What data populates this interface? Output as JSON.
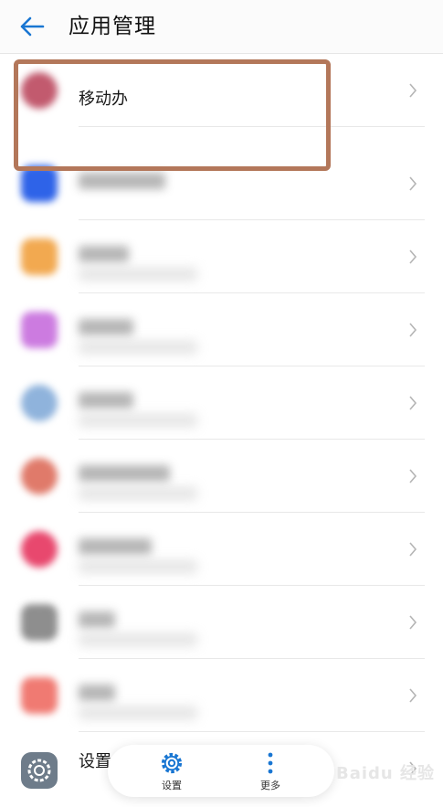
{
  "header": {
    "title": "应用管理"
  },
  "list": {
    "items": [
      {
        "label": "移动办",
        "color": "#c25a6e",
        "blurred_name": false
      },
      {
        "label": "",
        "color": "#2e63e8",
        "blurred_name": true
      },
      {
        "label": "",
        "color": "#f2a950",
        "blurred_name": true
      },
      {
        "label": "",
        "color": "#cc7be0",
        "blurred_name": true
      },
      {
        "label": "",
        "color": "#8fb3dc",
        "blurred_name": true
      },
      {
        "label": "",
        "color": "#e07a6a",
        "blurred_name": true
      },
      {
        "label": "",
        "color": "#e8486e",
        "blurred_name": true
      },
      {
        "label": "",
        "color": "#8e8e8e",
        "blurred_name": true
      },
      {
        "label": "",
        "color": "#f07a72",
        "blurred_name": true
      },
      {
        "label": "设置",
        "color": "#6e7c8a",
        "blurred_name": false
      }
    ]
  },
  "bottom_bar": {
    "settings_label": "设置",
    "more_label": "更多"
  },
  "watermark": {
    "text": "Baidu 经验"
  },
  "colors": {
    "accent": "#1976d2",
    "highlight": "#b3775a"
  }
}
